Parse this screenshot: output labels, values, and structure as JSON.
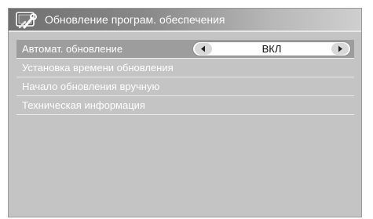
{
  "window": {
    "title": "Обновление програм. обеспечения",
    "title_icon": "tools-icon"
  },
  "menu": {
    "items": [
      {
        "label": "Автомат. обновление",
        "value": "ВКЛ",
        "selected": true
      },
      {
        "label": "Установка времени обновления"
      },
      {
        "label": "Начало обновления вручную"
      },
      {
        "label": "Техническая информация"
      }
    ]
  },
  "colors": {
    "panel": "#c4c4c4",
    "selected_row": "#9d9d9d",
    "text": "#ffffff"
  }
}
